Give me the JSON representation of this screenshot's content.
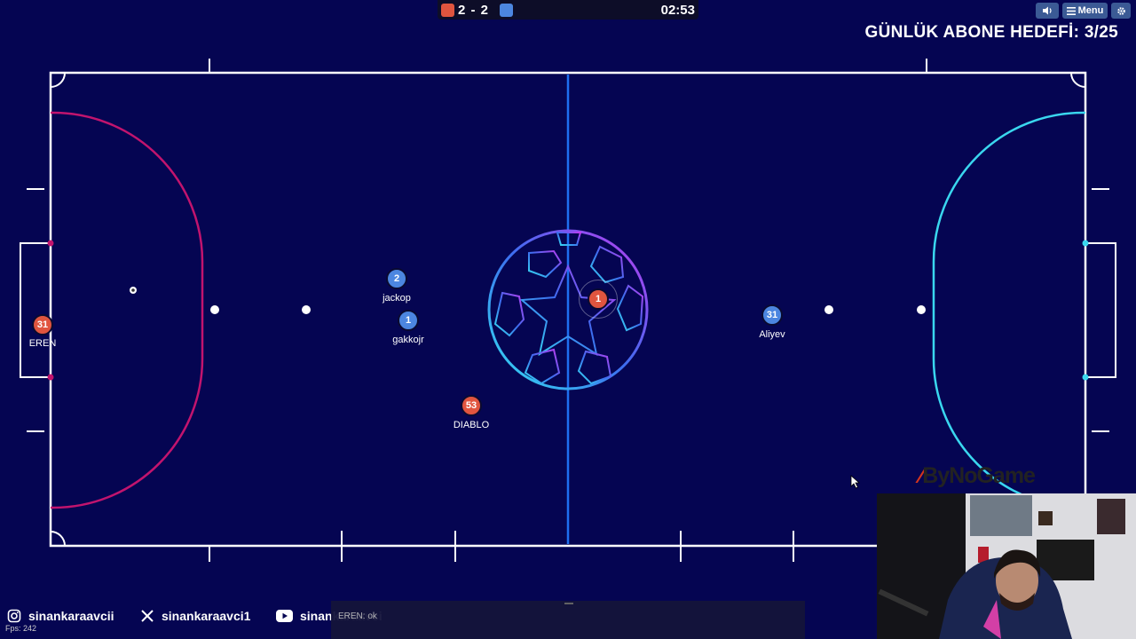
{
  "scoreboard": {
    "red_score": 2,
    "blue_score": 2,
    "score_text": "2 - 2",
    "timer": "02:53",
    "red_color": "#e0553f",
    "blue_color": "#4c86e0"
  },
  "top_buttons": {
    "menu_label": "Menu",
    "sound_icon": "speaker-icon",
    "settings_icon": "gear-icon"
  },
  "goal_banner": "GÜNLÜK ABONE HEDEFİ: 3/25",
  "field": {
    "line_color": "#ffffff",
    "left_area_color": "#c2146e",
    "right_area_color": "#3ad7ef",
    "center_line_color": "#1e6ff0"
  },
  "players": [
    {
      "number": "31",
      "name": "EREN",
      "team": "red"
    },
    {
      "number": "2",
      "name": "jackop",
      "team": "blue"
    },
    {
      "number": "1",
      "name": "gakkojr",
      "team": "blue"
    },
    {
      "number": "1",
      "name": "",
      "team": "red"
    },
    {
      "number": "53",
      "name": "DIABLO",
      "team": "red"
    },
    {
      "number": "31",
      "name": "Aliyev",
      "team": "blue"
    }
  ],
  "watermark": "ByNoGame",
  "social": {
    "instagram": "sinankaraavcii",
    "x": "sinankaraavci1",
    "youtube": "sinankaraavci"
  },
  "fps": "Fps: 242",
  "chat": {
    "partial_text": "EREN: ok"
  }
}
